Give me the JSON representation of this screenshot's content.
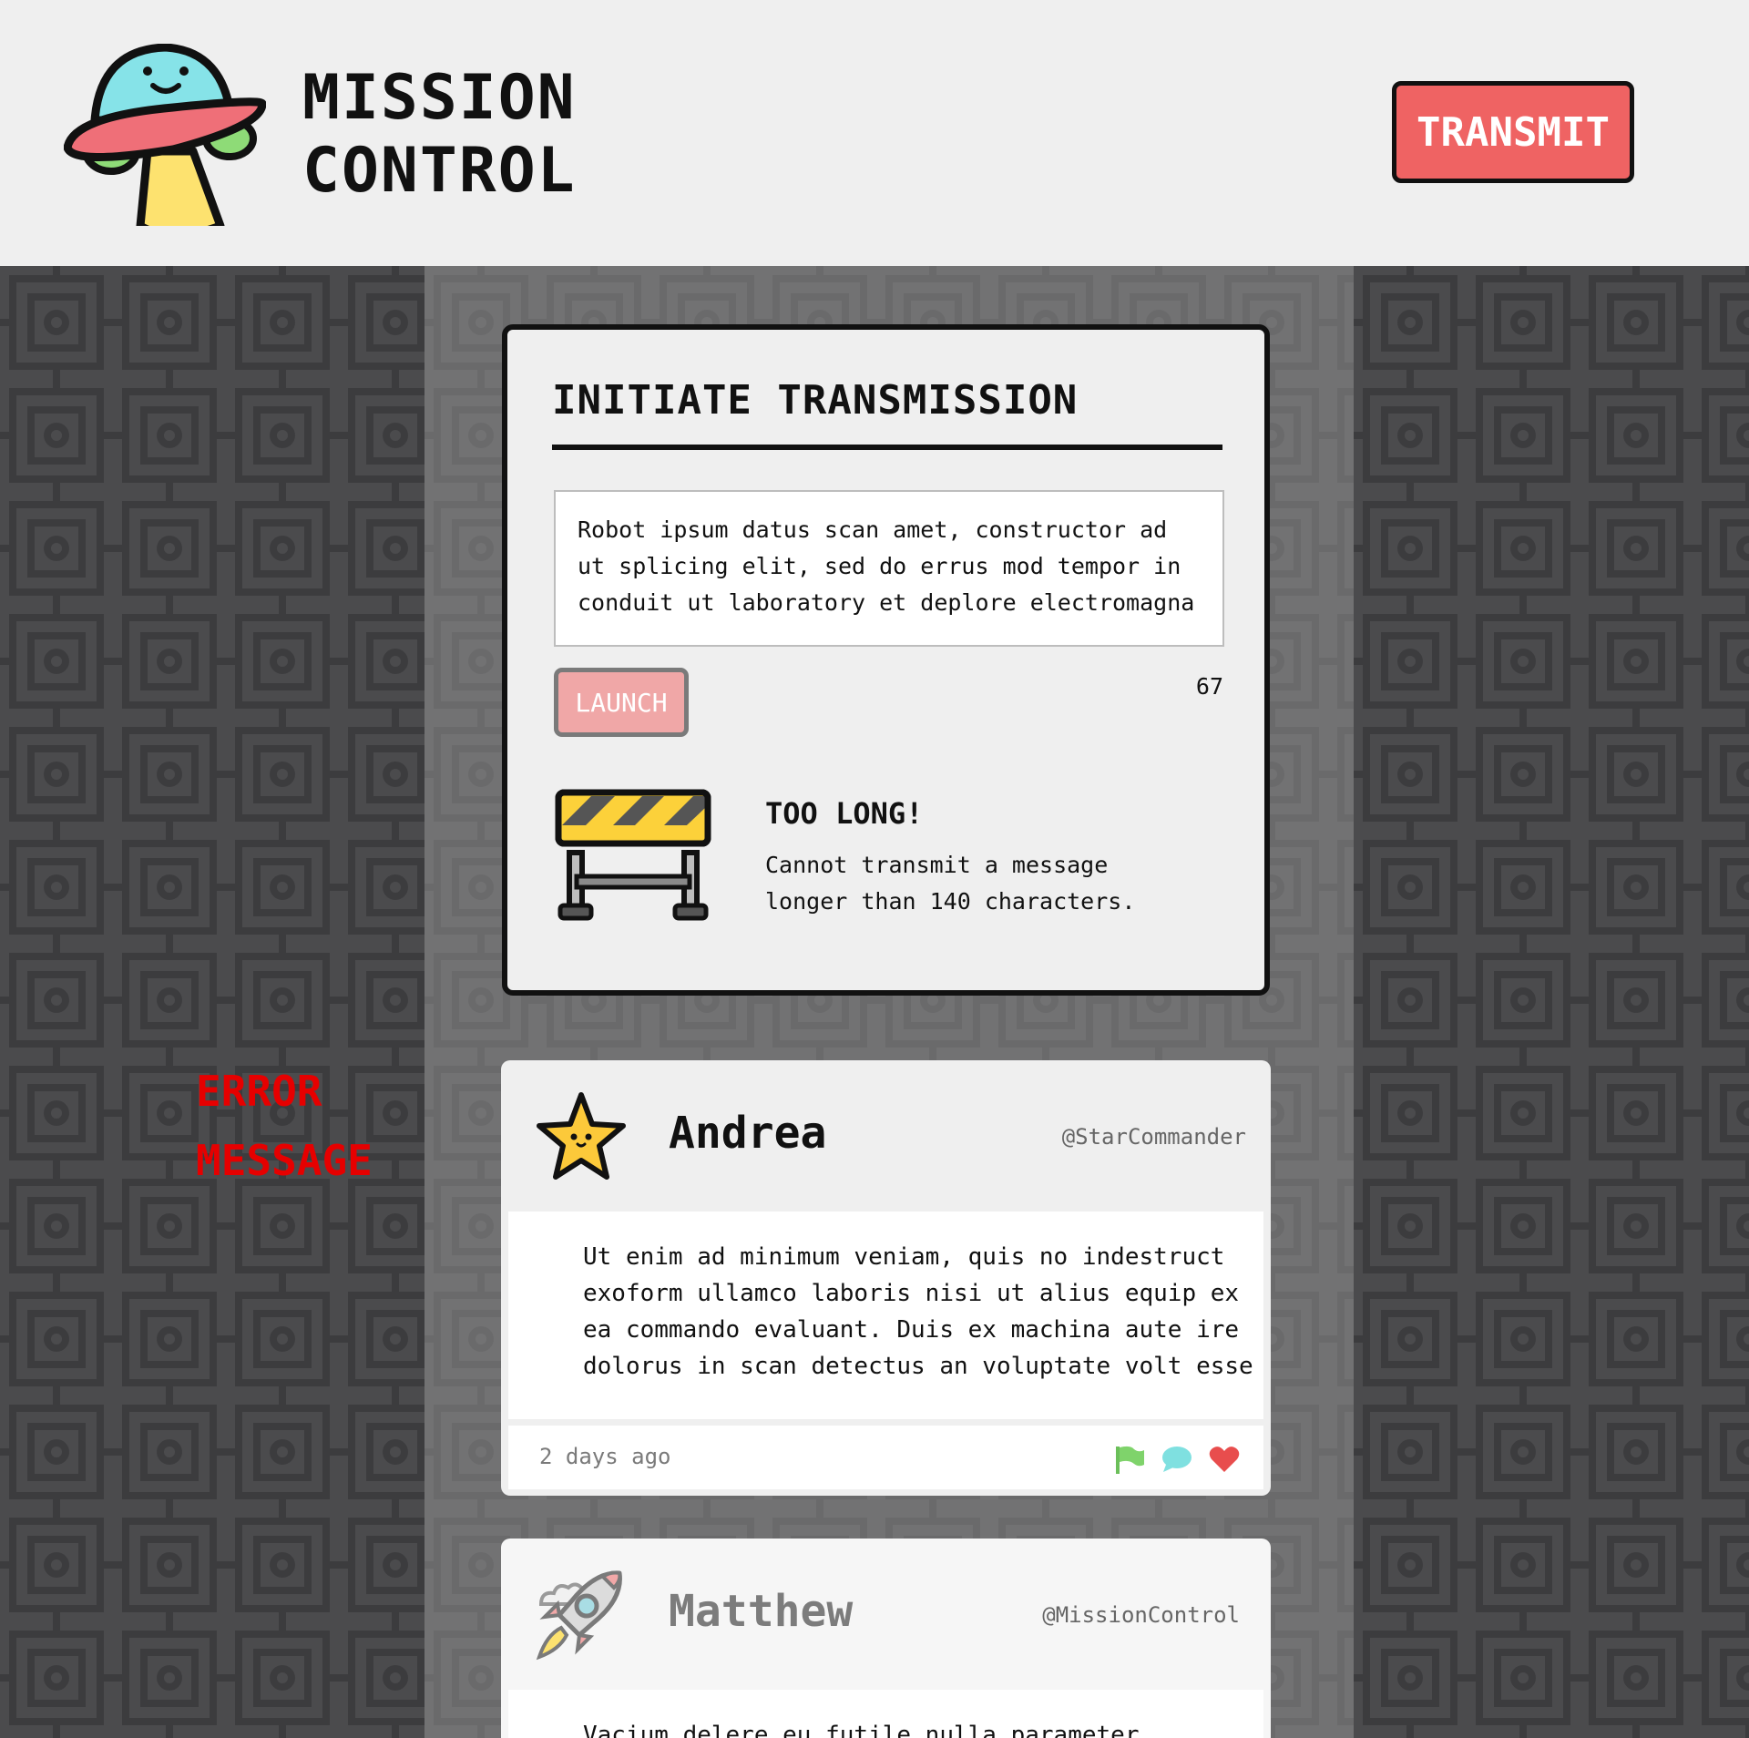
{
  "header": {
    "brand_line1": "MISSION",
    "brand_line2": "CONTROL",
    "transmit_label": "TRANSMIT"
  },
  "annotation": {
    "line1": "ERROR",
    "line2": "MESSAGE"
  },
  "compose": {
    "title": "INITIATE TRANSMISSION",
    "message": "Robot ipsum datus scan amet, constructor ad ut splicing elit, sed do errus mod tempor in conduit ut laboratory et deplore electromagna",
    "launch_label": "LAUNCH",
    "char_count": "67",
    "error_title": "TOO LONG!",
    "error_body": "Cannot transmit a message longer than 140 characters."
  },
  "posts": [
    {
      "name": "Andrea",
      "handle": "@StarCommander",
      "body": "Ut enim ad minimum veniam, quis no indestruct exoform ullamco laboris nisi ut alius equip ex ea commando evaluant. Duis ex machina aute ire dolorus in scan detectus an voluptate volt esse",
      "time": "2 days ago",
      "avatar_icon": "star-icon"
    },
    {
      "name": "Matthew",
      "handle": "@MissionControl",
      "body": "Vacium delere eu futile nulla parameter. Execute",
      "avatar_icon": "rocket-icon"
    }
  ],
  "colors": {
    "accent_red": "#ef6363",
    "launch_disabled": "#f0a7a7",
    "error_note": "#e60000",
    "flag_green": "#7fd36b",
    "comment_cyan": "#7fe0e0",
    "heart_red": "#e84d4d"
  }
}
